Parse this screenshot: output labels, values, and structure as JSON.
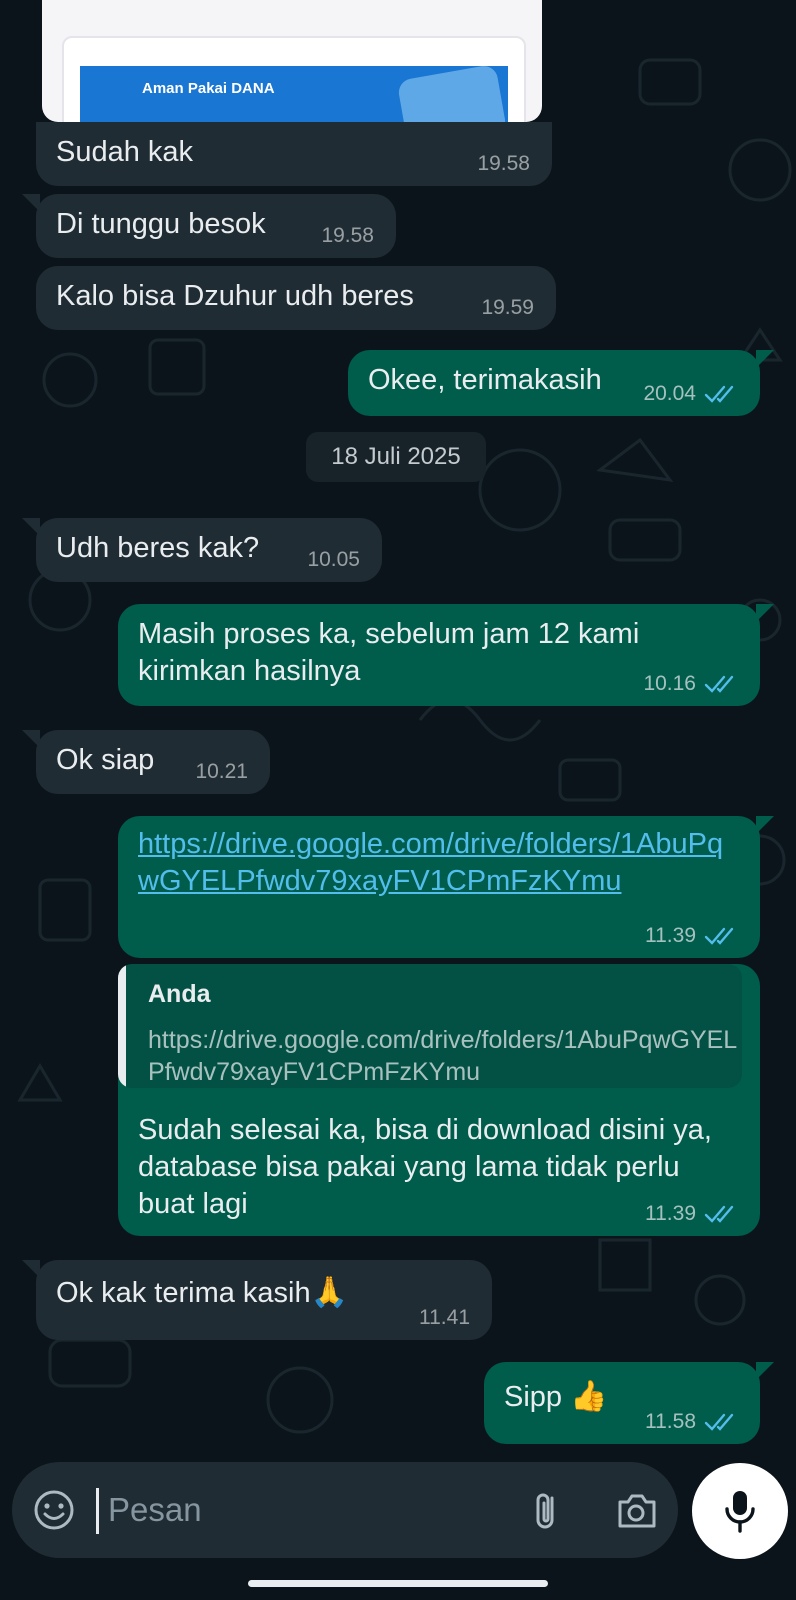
{
  "colors": {
    "background": "#0b141a",
    "incoming_bubble": "#202c33",
    "outgoing_bubble": "#005c4b",
    "link": "#53bdeb",
    "read_ticks": "#53bdeb"
  },
  "image_preview": {
    "banner_text": "Aman Pakai DANA"
  },
  "messages": [
    {
      "direction": "in",
      "text": "Sudah kak",
      "time": "19.58"
    },
    {
      "direction": "in",
      "text": "Di tunggu besok",
      "time": "19.58"
    },
    {
      "direction": "in",
      "text": "Kalo bisa Dzuhur udh beres",
      "time": "19.59"
    },
    {
      "direction": "out",
      "text": "Okee, terimakasih",
      "time": "20.04",
      "status": "read"
    },
    {
      "direction": "in",
      "text": "Udh beres kak?",
      "time": "10.05"
    },
    {
      "direction": "out",
      "text": "Masih proses ka, sebelum jam 12 kami kirimkan hasilnya",
      "time": "10.16",
      "status": "read"
    },
    {
      "direction": "in",
      "text": "Ok siap",
      "time": "10.21"
    },
    {
      "direction": "out",
      "text": "https://drive.google.com/drive/folders/1AbuPqwGYELPfwdv79xayFV1CPmFzKYmu",
      "time": "11.39",
      "status": "read"
    },
    {
      "direction": "out",
      "quote_author": "Anda",
      "quote_text": "https://drive.google.com/drive/folders/1AbuPqwGYELPfwdv79xayFV1CPmFzKYmu",
      "text": "Sudah selesai ka, bisa di download disini ya, database bisa pakai yang lama tidak perlu buat lagi",
      "time": "11.39",
      "status": "read"
    },
    {
      "direction": "in",
      "text": "Ok kak terima kasih",
      "emoji": "🙏",
      "time": "11.41"
    },
    {
      "direction": "out",
      "text": "Sipp",
      "emoji": "👍",
      "time": "11.58",
      "status": "read"
    }
  ],
  "date_separator": "18 Juli 2025",
  "composer": {
    "placeholder": "Pesan",
    "icons": [
      "sticker-icon",
      "paperclip-icon",
      "camera-icon",
      "microphone-icon"
    ]
  }
}
